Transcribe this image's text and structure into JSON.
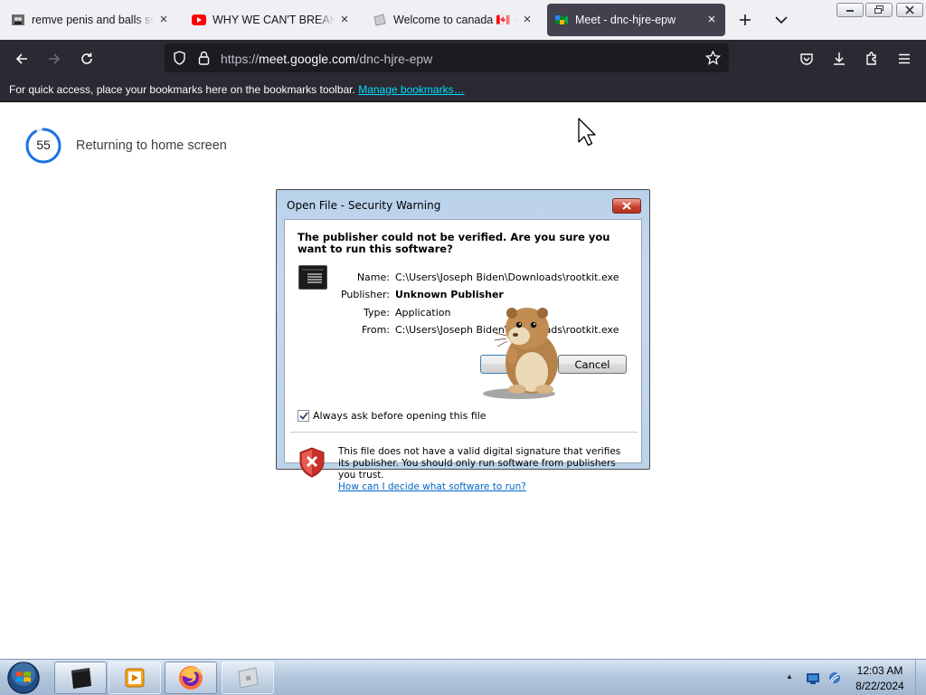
{
  "tabs": [
    {
      "title": "remve penis and balls surgery",
      "favicon": "dog-favicon",
      "close": "×"
    },
    {
      "title": "WHY WE CAN'T BREAK UP",
      "favicon": "youtube-favicon",
      "close": "×"
    },
    {
      "title": "Welcome to canada 🇨🇦 - ",
      "favicon": "image-favicon",
      "close": "×"
    },
    {
      "title": "Meet - dnc-hjre-epw",
      "favicon": "google-meet-favicon",
      "close": "×",
      "active": true
    }
  ],
  "address_bar": {
    "prefix": "https://",
    "host": "meet.google.com",
    "path": "/dnc-hjre-epw"
  },
  "bookmarks_bar": {
    "text": "For quick access, place your bookmarks here on the bookmarks toolbar.",
    "link": "Manage bookmarks…"
  },
  "page": {
    "countdown": "55",
    "countdown_fraction": 0.92,
    "message": "Returning to home screen"
  },
  "dialog": {
    "title": "Open File - Security Warning",
    "question": "The publisher could not be verified.  Are you sure you want to run this software?",
    "fields": [
      {
        "label": "Name:",
        "value": "C:\\Users\\Joseph Biden\\Downloads\\rootkit.exe",
        "bold": false
      },
      {
        "label": "Publisher:",
        "value": "Unknown Publisher",
        "bold": true
      },
      {
        "label": "Type:",
        "value": "Application",
        "bold": false
      },
      {
        "label": "From:",
        "value": "C:\\Users\\Joseph Biden\\Downloads\\rootkit.exe",
        "bold": false
      }
    ],
    "run_label": "",
    "cancel_label": "Cancel",
    "checkbox_label": "Always ask before opening this file",
    "checkbox_checked": true,
    "warning_text": "This file does not have a valid digital signature that verifies its publisher.  You should only run software from publishers you trust.",
    "warning_link": "How can I decide what software to run?"
  },
  "taskbar": {
    "time": "12:03 AM",
    "date": "8/22/2024"
  },
  "colors": {
    "firefox_dark": "#2b2a33",
    "urlbar": "#1c1b22",
    "link_cyan": "#00ddff",
    "meet_blue": "#1a73e8"
  }
}
